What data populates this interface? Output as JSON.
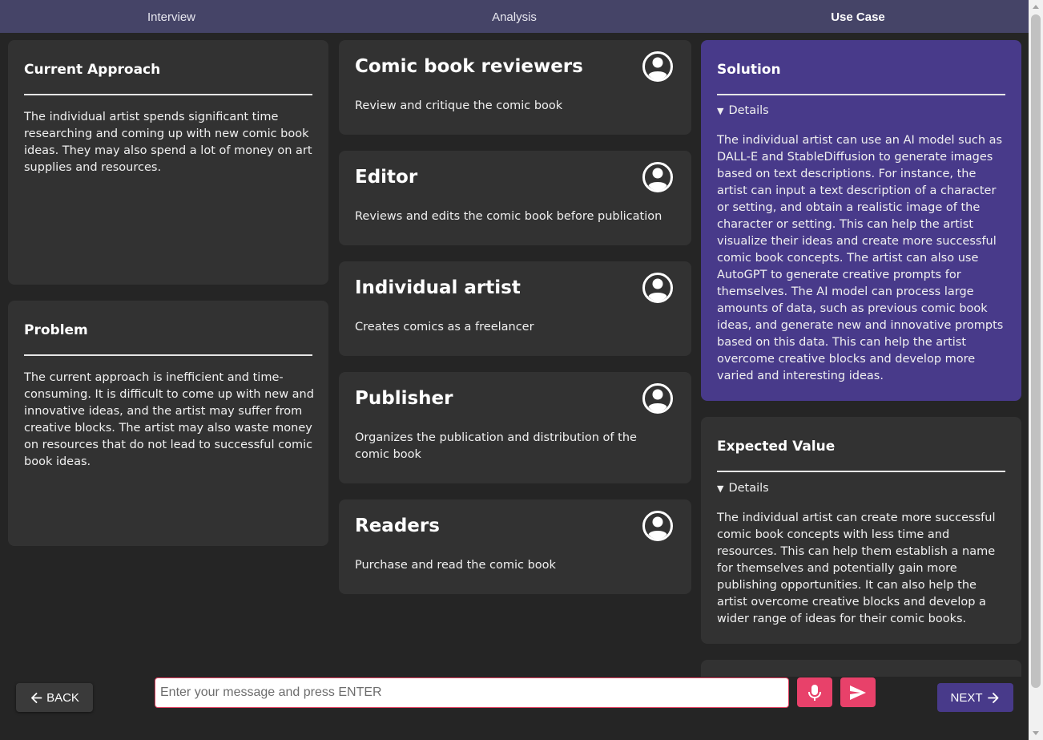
{
  "tabs": [
    {
      "label": "Interview"
    },
    {
      "label": "Analysis"
    },
    {
      "label": "Use Case",
      "active": true
    }
  ],
  "current_approach": {
    "title": "Current Approach",
    "body": "The individual artist spends significant time researching and coming up with new comic book ideas. They may also spend a lot of money on art supplies and resources."
  },
  "problem": {
    "title": "Problem",
    "body": "The current approach is inefficient and time-consuming. It is difficult to come up with new and innovative ideas, and the artist may suffer from creative blocks. The artist may also waste money on resources that do not lead to successful comic book ideas."
  },
  "roles": [
    {
      "title": "Comic book reviewers",
      "description": "Review and critique the comic book"
    },
    {
      "title": "Editor",
      "description": "Reviews and edits the comic book before publication"
    },
    {
      "title": "Individual artist",
      "description": "Creates comics as a freelancer"
    },
    {
      "title": "Publisher",
      "description": "Organizes the publication and distribution of the comic book"
    },
    {
      "title": "Readers",
      "description": "Purchase and read the comic book"
    }
  ],
  "solution": {
    "title": "Solution",
    "details_label": "Details",
    "body": "The individual artist can use an AI model such as DALL-E and StableDiffusion to generate images based on text descriptions. For instance, the artist can input a text description of a character or setting, and obtain a realistic image of the character or setting. This can help the artist visualize their ideas and create more successful comic book concepts. The artist can also use AutoGPT to generate creative prompts for themselves. The AI model can process large amounts of data, such as previous comic book ideas, and generate new and innovative prompts based on this data. This can help the artist overcome creative blocks and develop more varied and interesting ideas."
  },
  "expected_value": {
    "title": "Expected Value",
    "details_label": "Details",
    "body": "The individual artist can create more successful comic book concepts with less time and resources. This can help them establish a name for themselves and potentially gain more publishing opportunities. It can also help the artist overcome creative blocks and develop a wider range of ideas for their comic books."
  },
  "footer": {
    "back_label": "BACK",
    "next_label": "NEXT",
    "input_placeholder": "Enter your message and press ENTER"
  },
  "colors": {
    "topbar": "#454467",
    "accent_purple": "#483a8a",
    "accent_pink": "#e8416a",
    "card": "#323232",
    "background": "#252525"
  }
}
